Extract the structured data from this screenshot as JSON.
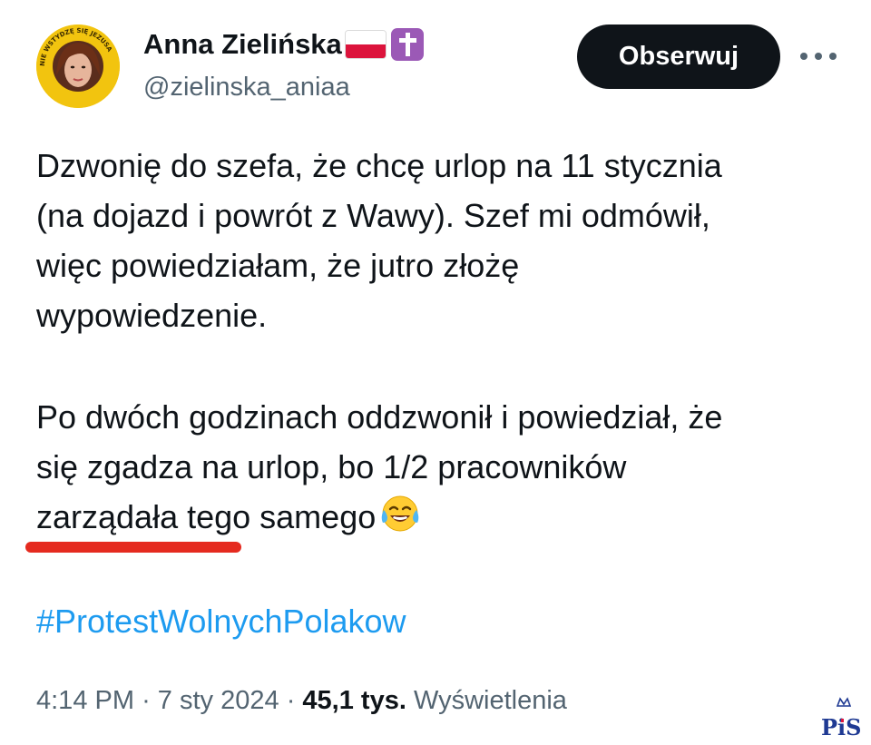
{
  "author": {
    "display_name": "Anna Zielińska",
    "handle": "@zielinska_aniaa",
    "avatar_ring_text": "NIE WSTYDZĘ SIĘ JEZUSA",
    "badges": [
      "poland-flag-icon",
      "latin-cross-icon"
    ]
  },
  "actions": {
    "follow_label": "Obserwuj",
    "more_icon": "more-dots-icon"
  },
  "tweet": {
    "lines_para1": [
      "Dzwonię do szefa, że chcę urlop na 11 stycznia",
      "(na dojazd i powrót z Wawy). Szef mi odmówił,",
      "więc powiedziałam, że jutro złożę",
      "wypowiedzenie."
    ],
    "lines_para2": [
      "Po dwóch godzinach oddzwonił i powiedział, że",
      "się zgadza na urlop, bo 1/2 pracowników",
      "zarządała tego samego"
    ],
    "emoji": "tears-of-joy-icon",
    "hashtag": "#ProtestWolnychPolakow"
  },
  "meta": {
    "time": "4:14 PM",
    "separator": "·",
    "date": "7 sty 2024",
    "views_count": "45,1 tys.",
    "views_label": "Wyświetlenia"
  },
  "watermark": {
    "text": "PiS"
  },
  "colors": {
    "text": "#0f1419",
    "secondary": "#536471",
    "link": "#1d9bf0",
    "button_bg": "#0f1419",
    "underline_mark": "#e52a1f",
    "avatar_ring": "#f2c40f"
  }
}
